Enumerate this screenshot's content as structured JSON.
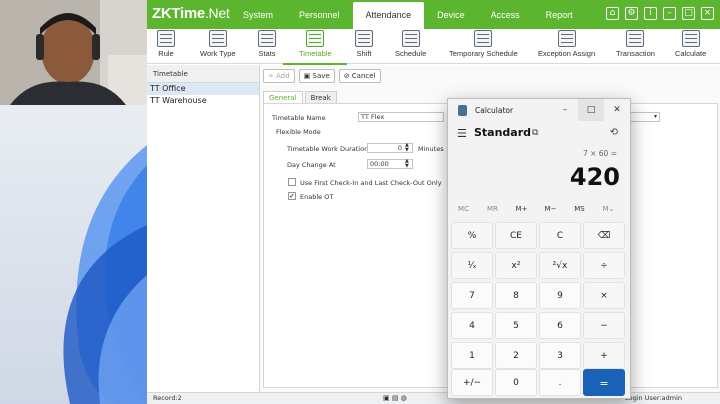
{
  "app": {
    "logo": {
      "brand": "ZKTime",
      "suffix": ".Net"
    },
    "menu": [
      "System",
      "Personnel",
      "Attendance",
      "Device",
      "Access",
      "Report"
    ],
    "active_menu": "Attendance",
    "toolbar": [
      "Rule",
      "Work Type",
      "Stats",
      "Timetable",
      "Shift",
      "Schedule",
      "Temporary Schedule",
      "Exception Assign",
      "Transaction",
      "Calculate"
    ],
    "active_tool": "Timetable",
    "left_panel": {
      "header": "Timetable",
      "items": [
        "TT Office",
        "TT Warehouse"
      ]
    },
    "actions": {
      "add": "Add",
      "save": "Save",
      "cancel": "Cancel"
    },
    "tabs": [
      "General",
      "Break"
    ],
    "form": {
      "timetable_name_label": "Timetable Name",
      "timetable_name_value": "TT Flex",
      "section": "Flexible Mode",
      "duration_label": "Timetable Work Duration",
      "duration_value": "0",
      "duration_unit": "Minutes",
      "day_change_label": "Day Change At",
      "day_change_value": "00:00",
      "first_last_label": "Use First Check-In and Last Check-Out Only",
      "enable_ot_label": "Enable OT",
      "enable_ot_checked": true
    },
    "status": {
      "record": "Record:2",
      "user": "Login User:admin"
    }
  },
  "calculator": {
    "title": "Calculator",
    "mode": "Standard",
    "expression": "7 × 60 =",
    "result": "420",
    "memory": [
      "MC",
      "MR",
      "M+",
      "M−",
      "MS",
      "M⌄"
    ],
    "keys": [
      "%",
      "CE",
      "C",
      "⌫",
      "¹⁄ₓ",
      "x²",
      "²√x",
      "÷",
      "7",
      "8",
      "9",
      "×",
      "4",
      "5",
      "6",
      "−",
      "1",
      "2",
      "3",
      "+",
      "+/−",
      "0",
      ".",
      "="
    ]
  },
  "colors": {
    "brand_green": "#5bb52e",
    "calc_equals": "#1a62b8"
  }
}
